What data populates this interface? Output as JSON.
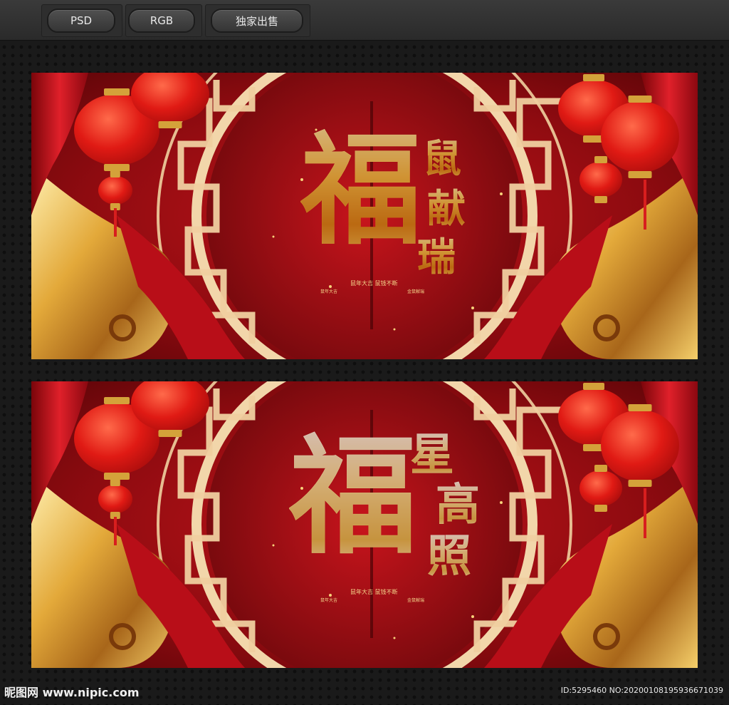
{
  "tags": [
    "PSD",
    "RGB",
    "独家出售"
  ],
  "banner1": {
    "big_char": "福",
    "side_chars": [
      "鼠",
      "献",
      "瑞"
    ],
    "caption": "鼠年大吉  鼠钱不断",
    "sub_left": "鼠年大吉",
    "sub_right": "金鼠献瑞"
  },
  "banner2": {
    "big_char": "福",
    "side_chars": [
      "星",
      "高",
      "照"
    ],
    "caption": "鼠年大吉  鼠钱不断",
    "sub_left": "鼠年大吉",
    "sub_right": "金鼠献瑞"
  },
  "footer": {
    "logo": "昵图网 www.nipic.com",
    "id_text": "ID:5295460 NO:20200108195936671039"
  },
  "colors": {
    "red": "#b0101a",
    "gold": "#e8b54a",
    "bg": "#1a1a1a"
  }
}
